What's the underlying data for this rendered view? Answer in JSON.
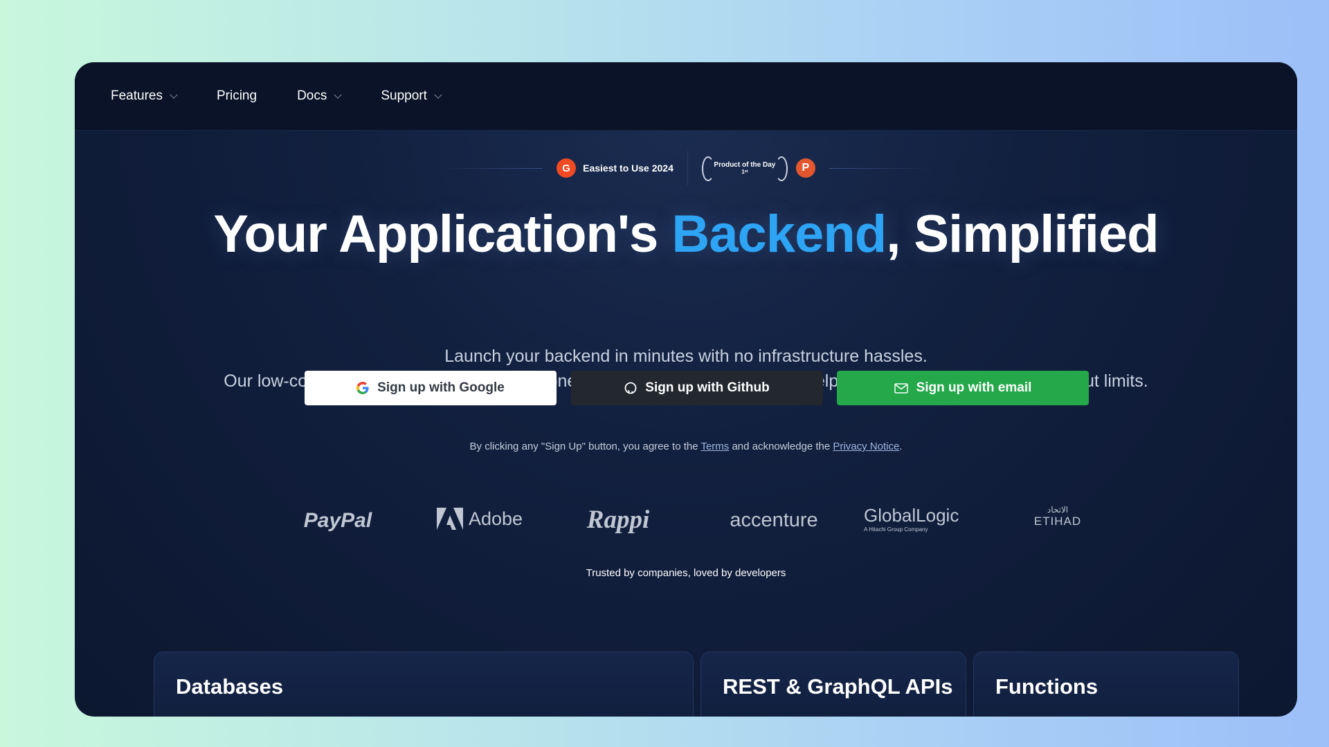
{
  "nav": {
    "items": [
      {
        "label": "Features",
        "has_dropdown": true
      },
      {
        "label": "Pricing",
        "has_dropdown": false
      },
      {
        "label": "Docs",
        "has_dropdown": true
      },
      {
        "label": "Support",
        "has_dropdown": true
      }
    ]
  },
  "badges": {
    "g2_icon": "G",
    "g2_label": "Easiest to Use 2024",
    "ph_line1": "Product of the Day",
    "ph_line2": "1ˢᵗ",
    "ph_icon": "P"
  },
  "hero": {
    "title_pre": "Your Application's ",
    "title_accent": "Backend",
    "title_post": ", Simplified",
    "accent_color": "#2ea4f5",
    "subtitle_1": "Launch your backend in minutes with no infrastructure hassles.",
    "subtitle_2": "Our low-code platform, ready-to-use components, and AI-powered tools will help you build faster and scale without limits."
  },
  "buttons": {
    "google": "Sign up with Google",
    "github": "Sign up with Github",
    "email": "Sign up with email"
  },
  "legal": {
    "pre": "By clicking any \"Sign Up\" button, you agree to the ",
    "terms": "Terms",
    "mid": " and acknowledge the ",
    "privacy": "Privacy Notice",
    "post": "."
  },
  "logos": {
    "paypal": "PayPal",
    "adobe": "Adobe",
    "rappi": "Rappi",
    "accenture": "accenture",
    "globallogic": "GlobalLogic",
    "globallogic_sub": "A Hitachi Group Company",
    "etihad": "ETIHAD",
    "etihad_arabic": "الاتحاد"
  },
  "trusted": "Trusted by companies, loved by developers",
  "cards": [
    {
      "title": "Databases"
    },
    {
      "title": "REST & GraphQL APIs"
    },
    {
      "title": "Functions"
    }
  ]
}
